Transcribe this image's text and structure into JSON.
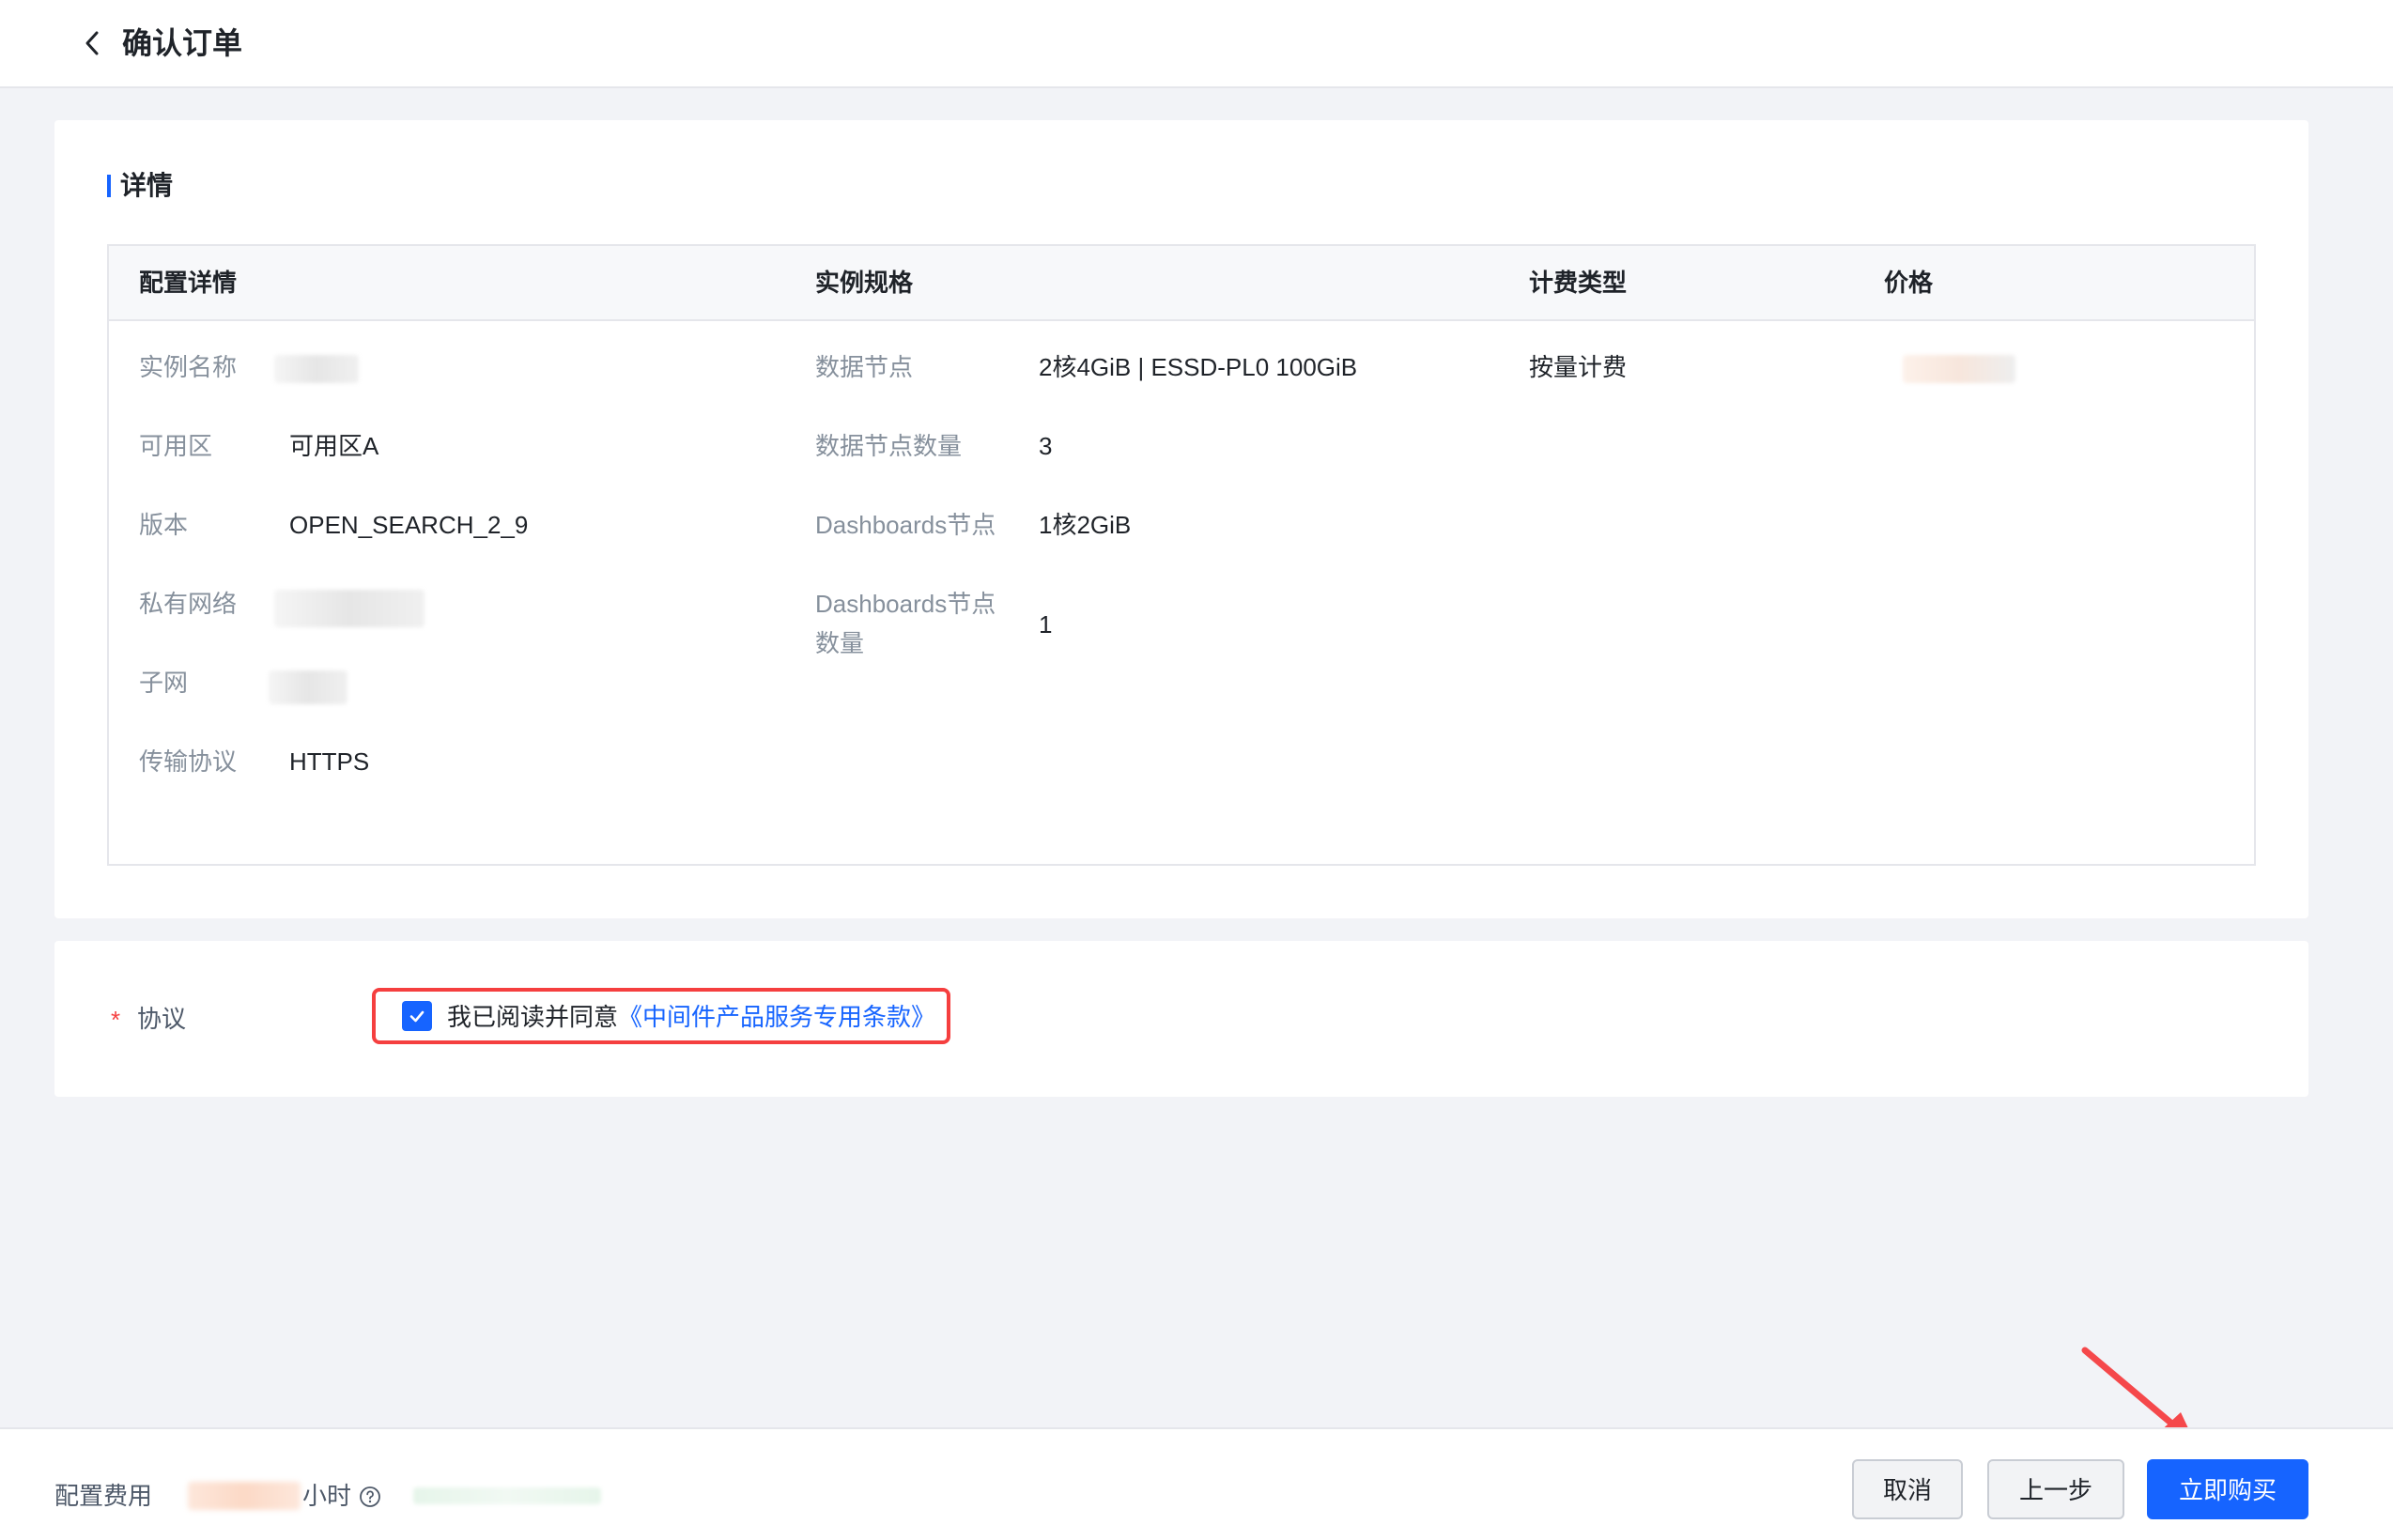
{
  "header": {
    "title": "确认订单"
  },
  "details": {
    "section_title": "详情",
    "columns": [
      "配置详情",
      "实例规格",
      "计费类型",
      "价格"
    ],
    "config": [
      {
        "label": "实例名称",
        "value": ""
      },
      {
        "label": "可用区",
        "value": "可用区A"
      },
      {
        "label": "版本",
        "value": "OPEN_SEARCH_2_9"
      },
      {
        "label": "私有网络",
        "value": ""
      },
      {
        "label": "子网",
        "value": ""
      },
      {
        "label": "传输协议",
        "value": "HTTPS"
      }
    ],
    "spec": [
      {
        "label": "数据节点",
        "value": "2核4GiB | ESSD-PL0 100GiB"
      },
      {
        "label": "数据节点数量",
        "value": "3"
      },
      {
        "label": "Dashboards节点",
        "value": "1核2GiB"
      },
      {
        "label": "Dashboards节点数量",
        "value": "1"
      }
    ],
    "billing_type": "按量计费"
  },
  "agreement": {
    "label": "协议",
    "required_mark": "*",
    "checked": true,
    "text": "我已阅读并同意",
    "link": "《中间件产品服务专用条款》"
  },
  "footer": {
    "fee_label": "配置费用",
    "fee_unit": "小时",
    "buttons": {
      "cancel": "取消",
      "prev": "上一步",
      "buy": "立即购买"
    }
  },
  "colors": {
    "primary": "#1664ff",
    "danger": "#f53f3f",
    "annotation": "#f5484b"
  }
}
